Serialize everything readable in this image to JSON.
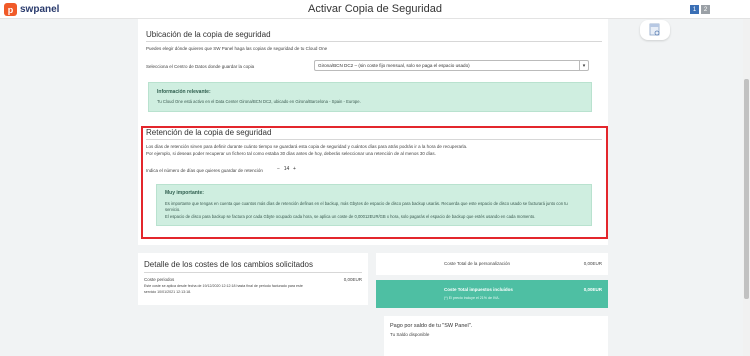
{
  "header": {
    "logo_mark": "p",
    "logo_text": "swpanel",
    "title": "Activar Copia de Seguridad",
    "steps": [
      "1",
      "2"
    ]
  },
  "ubicacion": {
    "title": "Ubicación de la copia de seguridad",
    "intro": "Puedes elegir dónde quieres que SW Panel haga las copias de seguridad de tu Cloud One",
    "select_label": "Selecciona el Centro de Datos donde guardar la copia",
    "select_value": "Girona/BCN DC2 – (sin coste fijo mensual, solo se paga el espacio usado)",
    "alert_title": "Información relevante:",
    "alert_text": "Tu Cloud One está activo en el Data Center Girona/BCN DC2, ubicado en Girona/Barcelona - Spain - Europe."
  },
  "retencion": {
    "title": "Retención de la copia de seguridad",
    "line1": "Los días de retención sirven para definir durante cuánto tiempo se guardará esta copia de seguridad y cuántos días para atrás podrás ir a la hora de recuperarla.",
    "line2": "Por ejemplo, si deseas poder recuperar un fichero tal como estaba 30 días antes de hoy, deberás seleccionar una retención de al menos 30 días.",
    "stepper_label": "Indica el número de días que quieres guardar de retención",
    "minus": "−",
    "days": "14",
    "plus": "+",
    "alert_title": "Muy importante:",
    "alert_line1": "Es importante que tengas en cuenta que cuantos más días de retención definas en el backup, más Gbytes de espacio de disco para backup usarás. Recuerda que este espacio de disco usado se facturará junto con tu",
    "alert_line2": "servicio.",
    "alert_line3": "El espacio de disco para backup se factura por cada Gbyte ocupado cada hora, se aplica un coste de 0,00012EUR/GB x hora, solo pagarás el espacio de backup que estés usando en cada momento."
  },
  "costes": {
    "title": "Detalle de los costes de los cambios solicitados",
    "periodos_label": "Coste periodos",
    "periodos_value": "0,00EUR",
    "note1": "Este coste se aplica desde fecha de 19/12/2020 12:12:18 hasta final de periodo facturado para este",
    "note2": "servicio 10/01/2021 12:13:18."
  },
  "summary": {
    "personalizacion_label": "Coste Total de la personalización",
    "personalizacion_value": "0,00EUR",
    "impuestos_label": "Coste Total impuestos incluidos",
    "impuestos_value": "0,00EUR",
    "impuestos_note": "(*) El precio incluye el 21% de IVA."
  },
  "pago": {
    "title": "Pago por saldo de tu \"SW Panel\".",
    "subtitle": "Tu Saldo disponible"
  },
  "colors": {
    "accent": "#4ebfa3",
    "alert_bg": "#cfeee0",
    "highlight": "#e3262c",
    "brand": "#f05a28"
  }
}
